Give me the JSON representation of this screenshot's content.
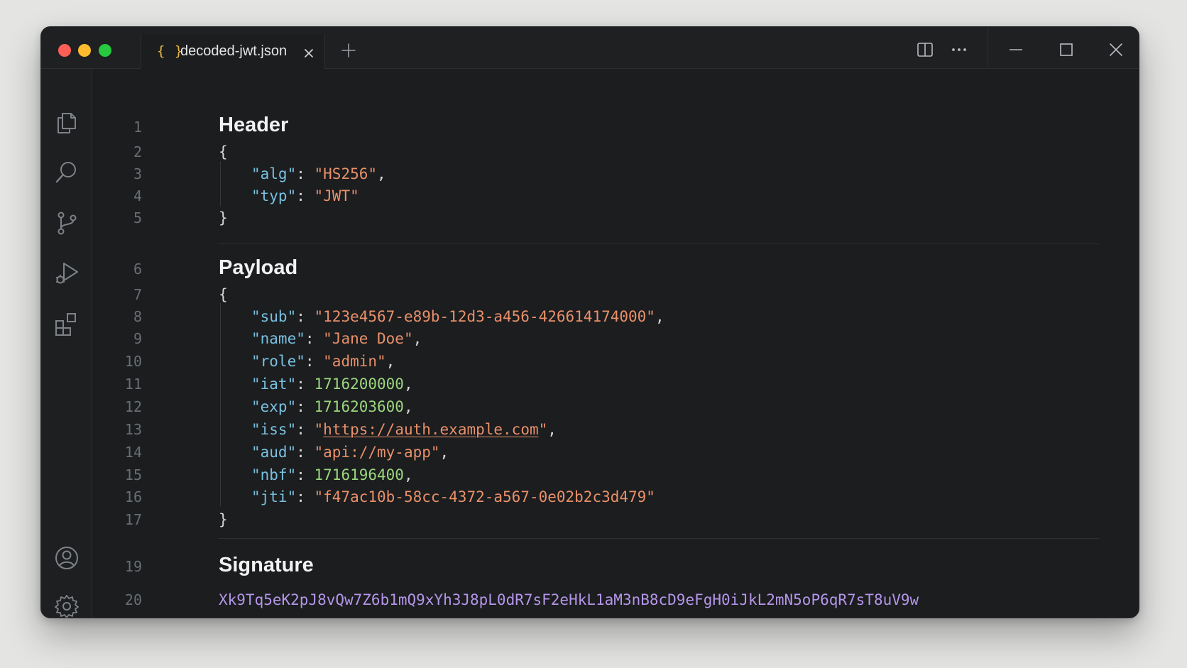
{
  "window": {
    "title": "decoded-jwt.json"
  },
  "tab": {
    "icon": "{ }",
    "label": "decoded-jwt.json",
    "icon_name": "json-braces-icon"
  },
  "colors": {
    "key": "#79c0e0",
    "string": "#e9906a",
    "number": "#9cd67e",
    "signature": "#b595e8",
    "background": "#1b1d1f",
    "tab_icon": "#e5b548"
  },
  "activity_bar": [
    {
      "name": "explorer-icon"
    },
    {
      "name": "search-icon"
    },
    {
      "name": "source-control-icon"
    },
    {
      "name": "run-debug-icon"
    },
    {
      "name": "extensions-icon"
    },
    {
      "name": "account-icon"
    },
    {
      "name": "settings-gear-icon"
    }
  ],
  "titlebar_actions": [
    "split-editor-icon",
    "more-actions-icon",
    "minimize-icon",
    "maximize-icon",
    "close-window-icon"
  ],
  "document": {
    "header": {
      "title": "Header",
      "title_line": "1",
      "open_brace": "{",
      "open_line": "2",
      "close_brace": "}",
      "close_line": "5",
      "fields": [
        {
          "line": "3",
          "key": "\"alg\"",
          "value": "\"HS256\"",
          "type": "string",
          "trail": ","
        },
        {
          "line": "4",
          "key": "\"typ\"",
          "value": "\"JWT\"",
          "type": "string",
          "trail": ""
        }
      ]
    },
    "payload": {
      "title": "Payload",
      "title_line": "6",
      "open_brace": "{",
      "open_line": "7",
      "close_brace": "}",
      "close_line": "17",
      "fields": [
        {
          "line": "8",
          "key": "\"sub\"",
          "value": "\"123e4567-e89b-12d3-a456-426614174000\"",
          "type": "string",
          "trail": ","
        },
        {
          "line": "9",
          "key": "\"name\"",
          "value": "\"Jane Doe\"",
          "type": "string",
          "trail": ","
        },
        {
          "line": "10",
          "key": "\"role\"",
          "value": "\"admin\"",
          "type": "string",
          "trail": ","
        },
        {
          "line": "11",
          "key": "\"iat\"",
          "value": "1716200000",
          "type": "number",
          "trail": ","
        },
        {
          "line": "12",
          "key": "\"exp\"",
          "value": "1716203600",
          "type": "number",
          "trail": ","
        },
        {
          "line": "13",
          "key": "\"iss\"",
          "value_prefix": "\"",
          "value_link": "https://auth.example.com",
          "value_suffix": "\"",
          "type": "link",
          "trail": ","
        },
        {
          "line": "14",
          "key": "\"aud\"",
          "value": "\"api://my-app\"",
          "type": "string",
          "trail": ","
        },
        {
          "line": "15",
          "key": "\"nbf\"",
          "value": "1716196400",
          "type": "number",
          "trail": ","
        },
        {
          "line": "16",
          "key": "\"jti\"",
          "value": "\"f47ac10b-58cc-4372-a567-0e02b2c3d479\"",
          "type": "string",
          "trail": ""
        }
      ]
    },
    "signature": {
      "title": "Signature",
      "title_line": "19",
      "value_line": "20",
      "value": "Xk9Tq5eK2pJ8vQw7Z6b1mQ9xYh3J8pL0dR7sF2eHkL1aM3nB8cD9eFgH0iJkL2mN5oP6qR7sT8uV9w"
    }
  }
}
